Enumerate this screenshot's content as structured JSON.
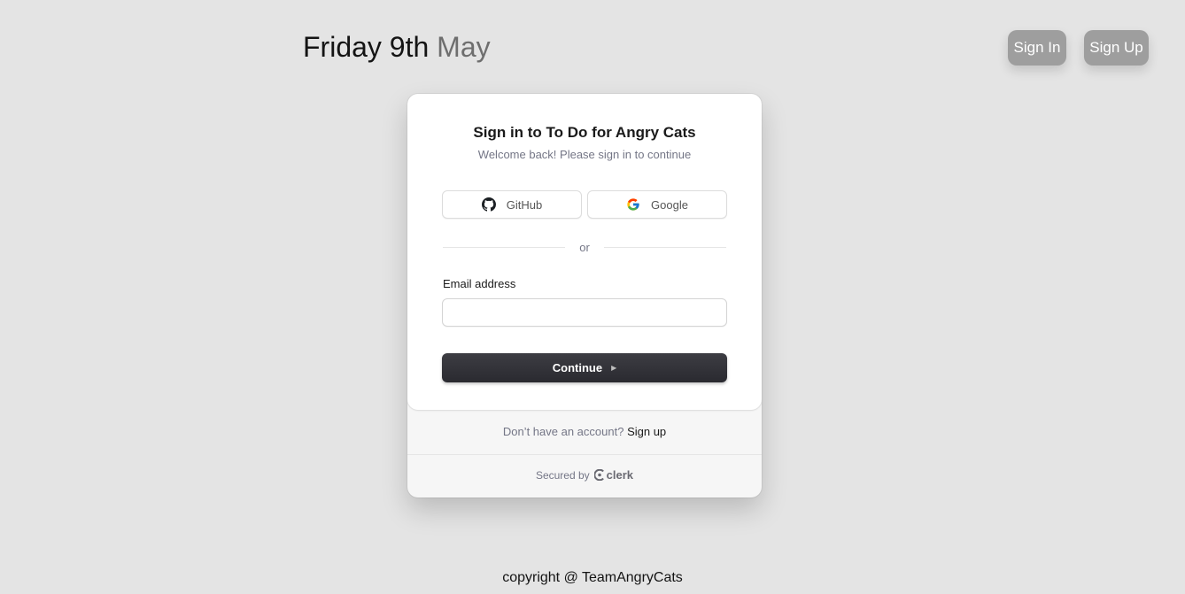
{
  "header": {
    "date_main": "Friday 9th",
    "date_month": "May",
    "sign_in_label": "Sign In",
    "sign_up_label": "Sign Up"
  },
  "signin_card": {
    "title": "Sign in to To Do for Angry Cats",
    "subtitle": "Welcome back! Please sign in to continue",
    "social": [
      {
        "label": "GitHub",
        "icon": "github-icon"
      },
      {
        "label": "Google",
        "icon": "google-icon"
      }
    ],
    "divider_text": "or",
    "email_label": "Email address",
    "email_value": "",
    "continue_label": "Continue",
    "no_account_text": "Don’t have an account?",
    "sign_up_link": "Sign up",
    "secured_by": "Secured by",
    "brand": "clerk"
  },
  "footer": {
    "copyright": "copyright @ TeamAngryCats"
  }
}
